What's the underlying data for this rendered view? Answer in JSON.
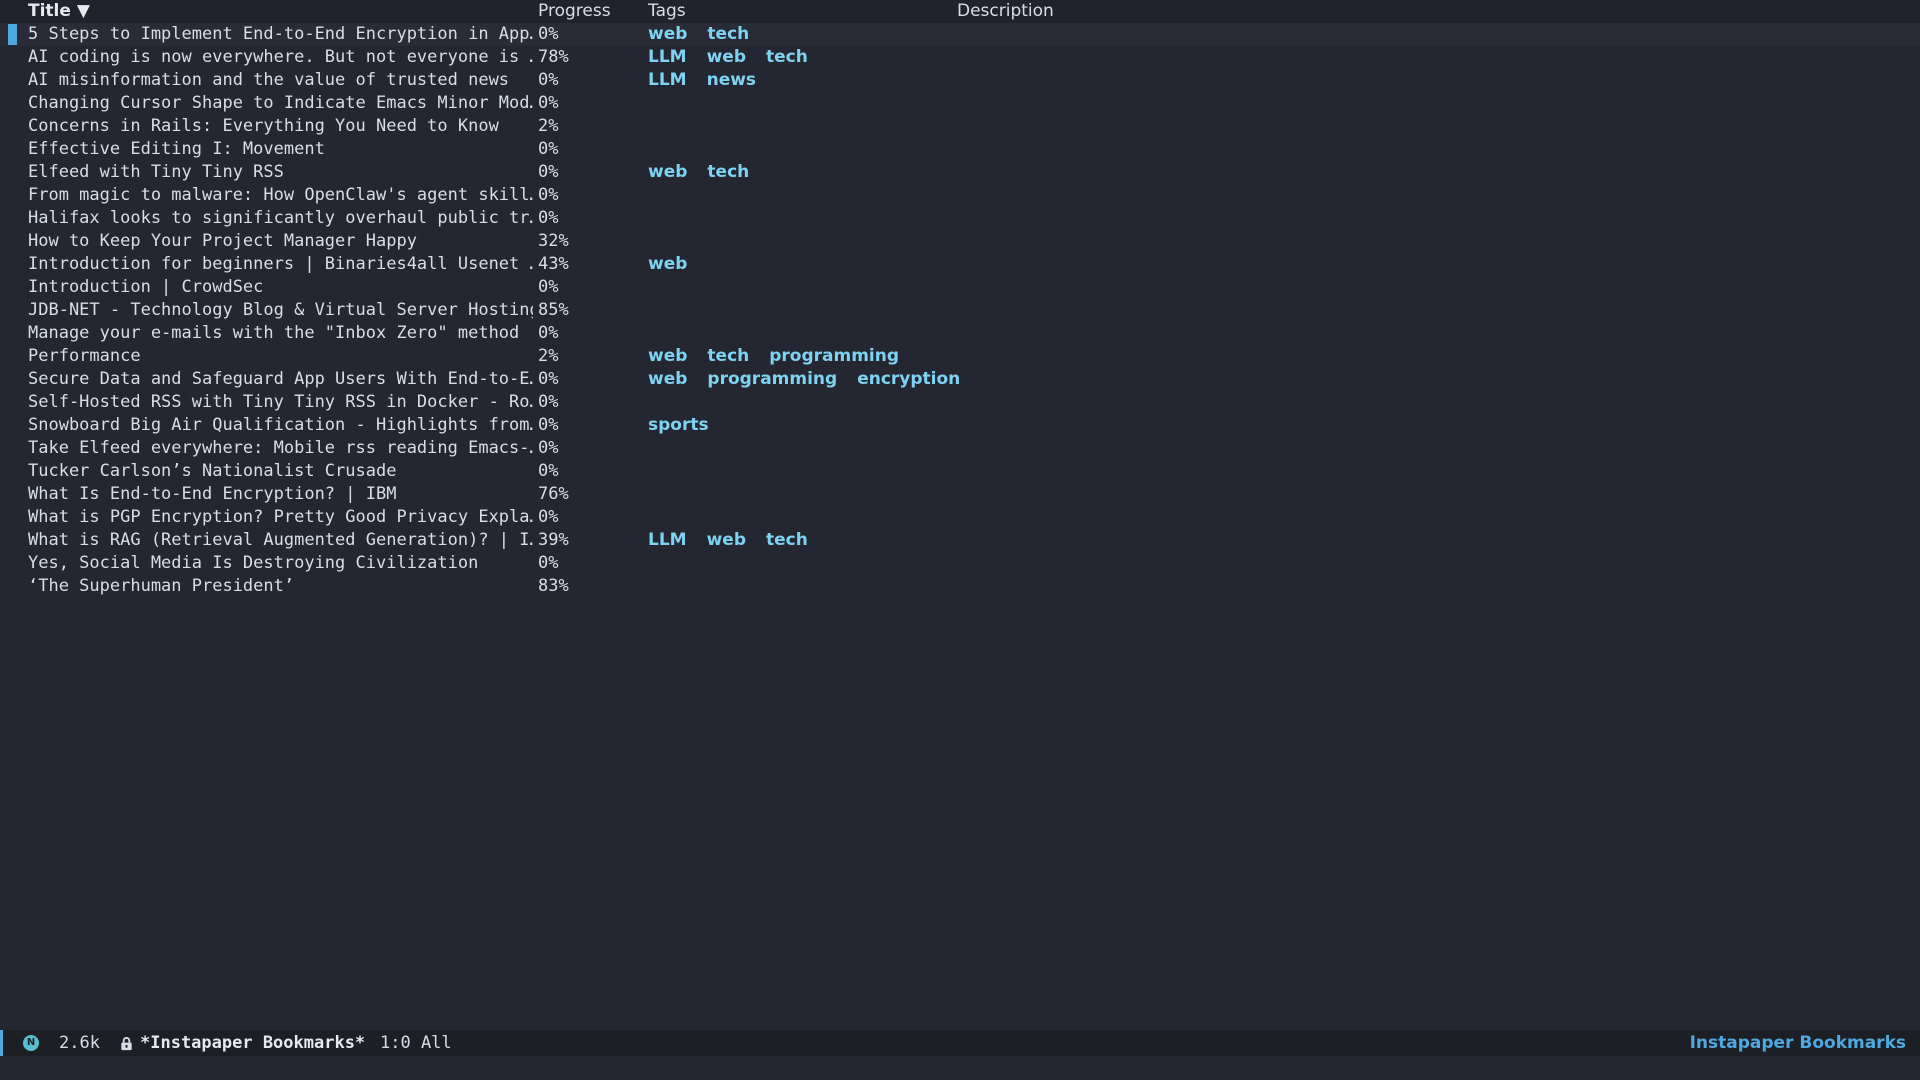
{
  "columns": {
    "title": "Title ▼",
    "progress": "Progress",
    "tags": "Tags",
    "description": "Description"
  },
  "rows": [
    {
      "title": "5 Steps to Implement End-to-End Encryption in App…",
      "progress": "0%",
      "tags": [
        "web",
        "tech"
      ]
    },
    {
      "title": "AI coding is now everywhere. But not everyone is …",
      "progress": "78%",
      "tags": [
        "LLM",
        "web",
        "tech"
      ]
    },
    {
      "title": "AI misinformation and the value of trusted news",
      "progress": "0%",
      "tags": [
        "LLM",
        "news"
      ]
    },
    {
      "title": "Changing Cursor Shape to Indicate Emacs Minor Mod…",
      "progress": "0%",
      "tags": []
    },
    {
      "title": "Concerns in Rails: Everything You Need to Know",
      "progress": "2%",
      "tags": []
    },
    {
      "title": "Effective Editing I: Movement",
      "progress": "0%",
      "tags": []
    },
    {
      "title": "Elfeed with Tiny Tiny RSS",
      "progress": "0%",
      "tags": [
        "web",
        "tech"
      ]
    },
    {
      "title": "From magic to malware: How OpenClaw's agent skill…",
      "progress": "0%",
      "tags": []
    },
    {
      "title": "Halifax looks to significantly overhaul public tr…",
      "progress": "0%",
      "tags": []
    },
    {
      "title": "How to Keep Your Project Manager Happy",
      "progress": "32%",
      "tags": []
    },
    {
      "title": "Introduction for beginners | Binaries4all Usenet …",
      "progress": "43%",
      "tags": [
        "web"
      ]
    },
    {
      "title": "Introduction | CrowdSec",
      "progress": "0%",
      "tags": []
    },
    {
      "title": "JDB-NET - Technology Blog & Virtual Server Hosting",
      "progress": "85%",
      "tags": []
    },
    {
      "title": "Manage your e-mails with the \"Inbox Zero\" method",
      "progress": "0%",
      "tags": []
    },
    {
      "title": "Performance",
      "progress": "2%",
      "tags": [
        "web",
        "tech",
        "programming"
      ]
    },
    {
      "title": "Secure Data and Safeguard App Users With End-to-E…",
      "progress": "0%",
      "tags": [
        "web",
        "programming",
        "encryption"
      ]
    },
    {
      "title": "Self-Hosted RSS with Tiny Tiny RSS in Docker - Ro…",
      "progress": "0%",
      "tags": []
    },
    {
      "title": "Snowboard Big Air Qualification - Highlights from…",
      "progress": "0%",
      "tags": [
        "sports"
      ]
    },
    {
      "title": "Take Elfeed everywhere: Mobile rss reading Emacs-…",
      "progress": "0%",
      "tags": []
    },
    {
      "title": "Tucker Carlson’s Nationalist Crusade",
      "progress": "0%",
      "tags": []
    },
    {
      "title": "What Is End-to-End Encryption? | IBM",
      "progress": "76%",
      "tags": []
    },
    {
      "title": "What is PGP Encryption? Pretty Good Privacy Expla…",
      "progress": "0%",
      "tags": []
    },
    {
      "title": "What is RAG (Retrieval Augmented Generation)? | I…",
      "progress": "39%",
      "tags": [
        "LLM",
        "web",
        "tech"
      ]
    },
    {
      "title": "Yes, Social Media Is Destroying Civilization",
      "progress": "0%",
      "tags": []
    },
    {
      "title": "‘The Superhuman President’",
      "progress": "83%",
      "tags": []
    }
  ],
  "modeline": {
    "mode_badge": "N",
    "buffer_size": "2.6k",
    "buffer_name": "*Instapaper Bookmarks*",
    "position": "1:0 All",
    "major_mode": "Instapaper Bookmarks"
  },
  "colors": {
    "background": "#242731",
    "tag": "#7dd3f0",
    "accent": "#4ea9e0"
  },
  "icons": {
    "mode_indicator": "circle-n-icon",
    "read_only": "lock-icon"
  }
}
